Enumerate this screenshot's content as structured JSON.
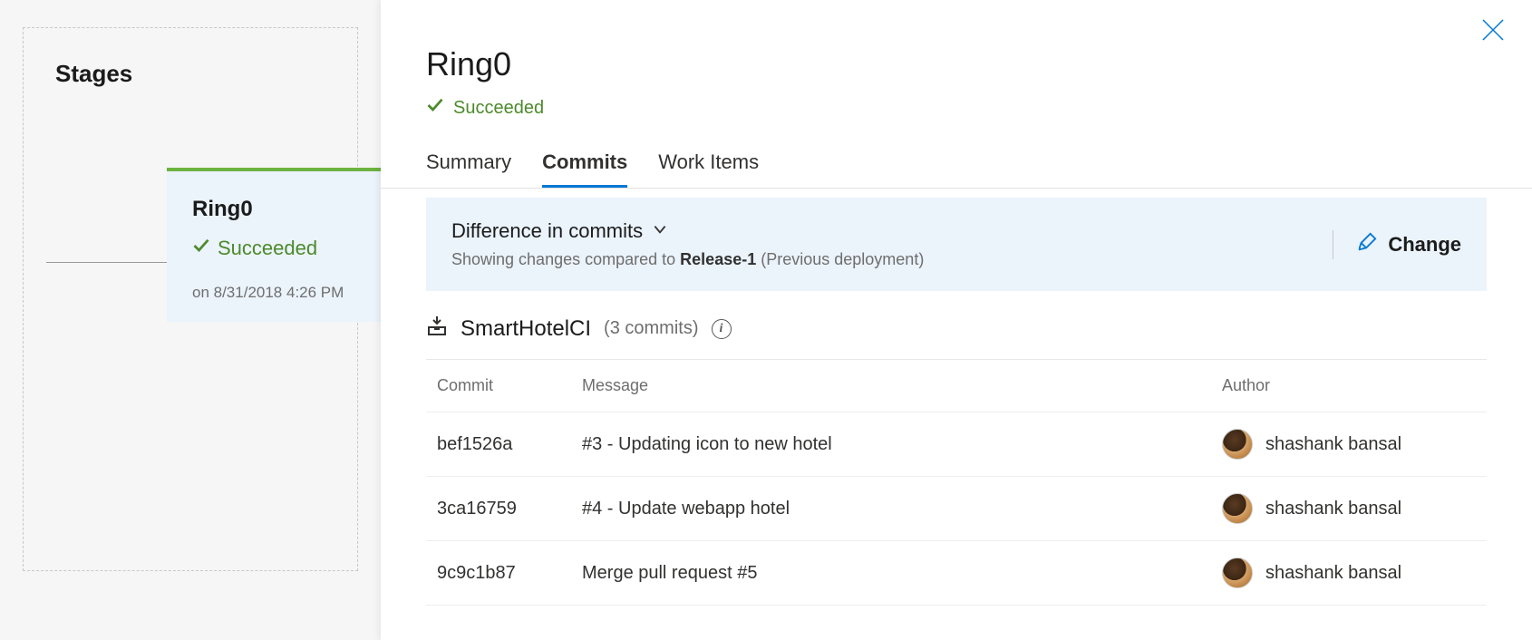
{
  "leftPanel": {
    "title": "Stages",
    "stage": {
      "name": "Ring0",
      "status": "Succeeded",
      "timestamp": "on 8/31/2018 4:26 PM"
    }
  },
  "detail": {
    "title": "Ring0",
    "status": "Succeeded",
    "tabs": {
      "summary": "Summary",
      "commits": "Commits",
      "workitems": "Work Items"
    },
    "diff": {
      "title": "Difference in commits",
      "sub_prefix": "Showing changes compared to ",
      "sub_release": "Release-1",
      "sub_suffix": " (Previous deployment)",
      "change": "Change"
    },
    "repo": {
      "name": "SmartHotelCI",
      "count": "(3 commits)"
    },
    "table": {
      "headers": {
        "commit": "Commit",
        "message": "Message",
        "author": "Author"
      },
      "rows": [
        {
          "commit": "bef1526a",
          "message": "#3 - Updating icon to new hotel",
          "author": "shashank bansal"
        },
        {
          "commit": "3ca16759",
          "message": "#4 - Update webapp hotel",
          "author": "shashank bansal"
        },
        {
          "commit": "9c9c1b87",
          "message": "Merge pull request #5",
          "author": "shashank bansal"
        }
      ]
    }
  }
}
